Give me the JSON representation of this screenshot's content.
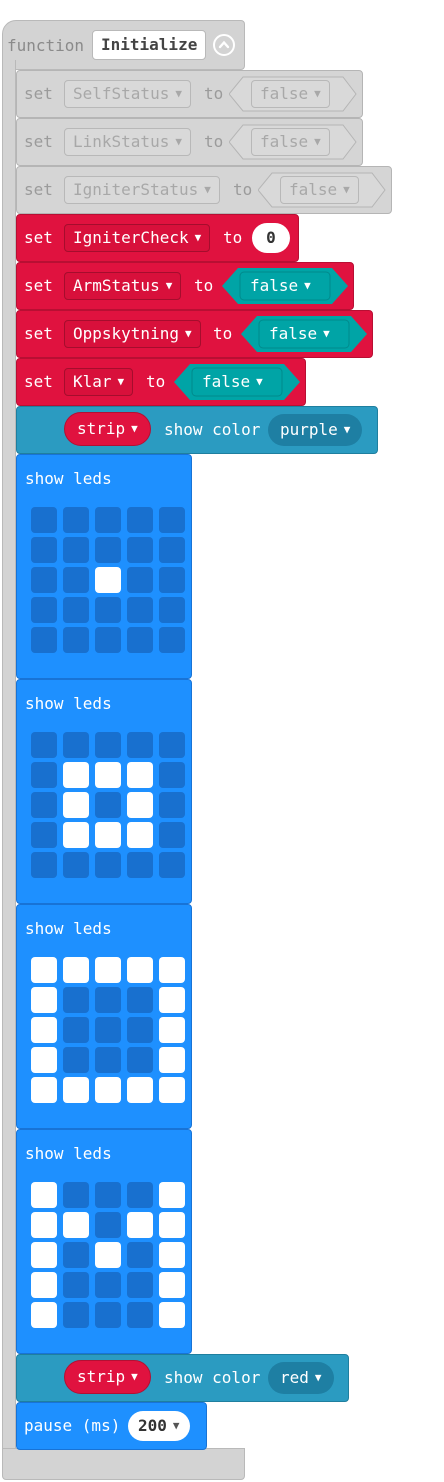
{
  "function_block": {
    "keyword": "function",
    "name": "Initialize"
  },
  "disabled_sets": [
    {
      "set": "set",
      "variable": "SelfStatus",
      "to": "to",
      "value": "false"
    },
    {
      "set": "set",
      "variable": "LinkStatus",
      "to": "to",
      "value": "false"
    },
    {
      "set": "set",
      "variable": "IgniterStatus",
      "to": "to",
      "value": "false"
    }
  ],
  "red_sets": [
    {
      "set": "set",
      "variable": "IgniterCheck",
      "to": "to",
      "value": "0"
    },
    {
      "set": "set",
      "variable": "ArmStatus",
      "to": "to",
      "value": "false"
    },
    {
      "set": "set",
      "variable": "Oppskytning",
      "to": "to",
      "value": "false"
    },
    {
      "set": "set",
      "variable": "Klar",
      "to": "to",
      "value": "false"
    }
  ],
  "neopixel_blocks": [
    {
      "strip": "strip",
      "action": "show color",
      "color": "purple"
    },
    {
      "strip": "strip",
      "action": "show color",
      "color": "red"
    }
  ],
  "show_leds": [
    {
      "label": "show leds",
      "grid": [
        [
          0,
          0,
          0,
          0,
          0
        ],
        [
          0,
          0,
          0,
          0,
          0
        ],
        [
          0,
          0,
          1,
          0,
          0
        ],
        [
          0,
          0,
          0,
          0,
          0
        ],
        [
          0,
          0,
          0,
          0,
          0
        ]
      ]
    },
    {
      "label": "show leds",
      "grid": [
        [
          0,
          0,
          0,
          0,
          0
        ],
        [
          0,
          1,
          1,
          1,
          0
        ],
        [
          0,
          1,
          0,
          1,
          0
        ],
        [
          0,
          1,
          1,
          1,
          0
        ],
        [
          0,
          0,
          0,
          0,
          0
        ]
      ]
    },
    {
      "label": "show leds",
      "grid": [
        [
          1,
          1,
          1,
          1,
          1
        ],
        [
          1,
          0,
          0,
          0,
          1
        ],
        [
          1,
          0,
          0,
          0,
          1
        ],
        [
          1,
          0,
          0,
          0,
          1
        ],
        [
          1,
          1,
          1,
          1,
          1
        ]
      ]
    },
    {
      "label": "show leds",
      "grid": [
        [
          1,
          0,
          0,
          0,
          1
        ],
        [
          1,
          1,
          0,
          1,
          1
        ],
        [
          1,
          0,
          1,
          0,
          1
        ],
        [
          1,
          0,
          0,
          0,
          1
        ],
        [
          1,
          0,
          0,
          0,
          1
        ]
      ]
    }
  ],
  "pause": {
    "label": "pause (ms)",
    "value": "200"
  },
  "icons": {
    "dropdown": "caret-down-icon",
    "collapse": "collapse-arrow-icon"
  },
  "colors": {
    "function_grey": "#d3d3d3",
    "variables_red": "#e0123f",
    "logic_teal": "#00a4a6",
    "neopixel_blue": "#2b9bc1",
    "basic_blue": "#1e90ff"
  }
}
